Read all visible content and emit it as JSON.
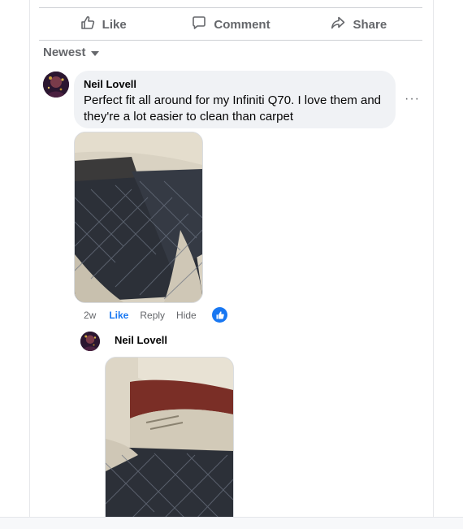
{
  "actions": {
    "like_label": "Like",
    "comment_label": "Comment",
    "share_label": "Share"
  },
  "sort": {
    "label": "Newest"
  },
  "comment": {
    "author": "Neil Lovell",
    "text_line1": "Perfect fit all around for my Infiniti Q70. I love them and",
    "text_line2": "they're a lot easier to clean than carpet",
    "more_label": "···",
    "time": "2w",
    "like_label": "Like",
    "reply_label": "Reply",
    "hide_label": "Hide",
    "reaction_icon": "thumbs-up-icon"
  },
  "reply": {
    "author": "Neil Lovell"
  },
  "colors": {
    "accent": "#1877f2",
    "muted": "#65676b",
    "bubble": "#f0f2f5"
  }
}
